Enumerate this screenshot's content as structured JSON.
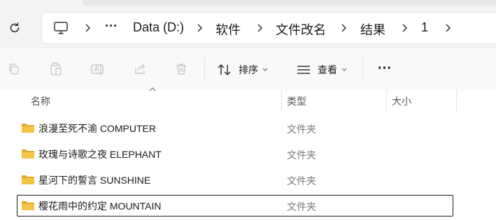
{
  "address": {
    "overflow": "···",
    "crumbs": [
      "Data (D:)",
      "软件",
      "文件改名",
      "结果",
      "1"
    ]
  },
  "toolbar": {
    "sort_label": "排序",
    "view_label": "查看",
    "more": "···"
  },
  "columns": {
    "name": "名称",
    "type": "类型",
    "size": "大小"
  },
  "files": [
    {
      "name": "浪漫至死不渝 COMPUTER",
      "type": "文件夹",
      "selected": false
    },
    {
      "name": "玫瑰与诗歌之夜 ELEPHANT",
      "type": "文件夹",
      "selected": false
    },
    {
      "name": "星河下的誓言 SUNSHINE",
      "type": "文件夹",
      "selected": false
    },
    {
      "name": "樱花雨中的约定 MOUNTAIN",
      "type": "文件夹",
      "selected": true
    }
  ],
  "colors": {
    "folder": "#f4c542",
    "folder_dark": "#e0a82e",
    "disabled_icon": "#c6c6c6"
  },
  "icons": [
    "refresh-icon",
    "computer-icon",
    "chevron-right-icon",
    "copy-icon",
    "paste-icon",
    "rename-icon",
    "share-icon",
    "delete-icon",
    "sort-icon",
    "view-icon",
    "more-icon",
    "folder-icon"
  ]
}
